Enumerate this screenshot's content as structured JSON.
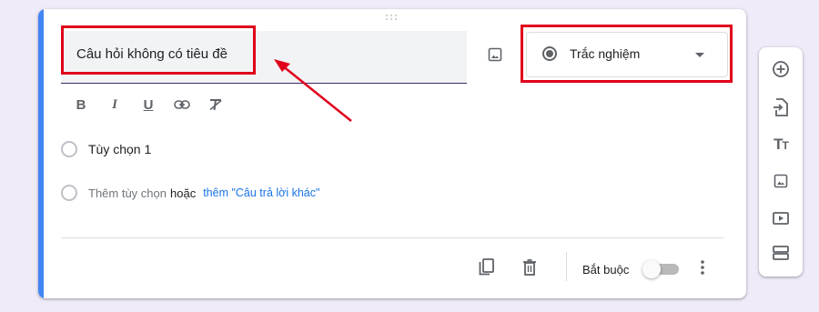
{
  "question": {
    "title": "Câu hỏi không có tiêu đề",
    "type_label": "Trắc nghiệm"
  },
  "format_toolbar": {
    "bold": "B",
    "italic": "I",
    "underline": "U"
  },
  "options": [
    {
      "label": "Tùy chọn 1"
    }
  ],
  "add_option": {
    "placeholder": "Thêm tùy chọn",
    "or": "hoặc",
    "add_other": "thêm \"Câu trả lời khác\""
  },
  "footer": {
    "required_label": "Bắt buộc",
    "required_on": false
  },
  "sidebar": {
    "text_icon_big": "T",
    "text_icon_small": "T"
  },
  "colors": {
    "accent": "#4285f4",
    "highlight": "#e0001b",
    "link": "#1a73e8",
    "background": "#f0ebf8"
  },
  "icons": {
    "image": "image-icon",
    "radio": "radio-button-icon",
    "dropdown": "arrow-drop-down-icon",
    "link": "link-icon",
    "clear_format": "clear-format-icon",
    "duplicate": "copy-icon",
    "delete": "trash-icon",
    "more": "more-vert-icon",
    "add_question": "add-circle-icon",
    "import_questions": "import-icon",
    "add_title": "title-text-icon",
    "add_image": "image-icon",
    "add_video": "video-icon",
    "add_section": "section-icon"
  }
}
